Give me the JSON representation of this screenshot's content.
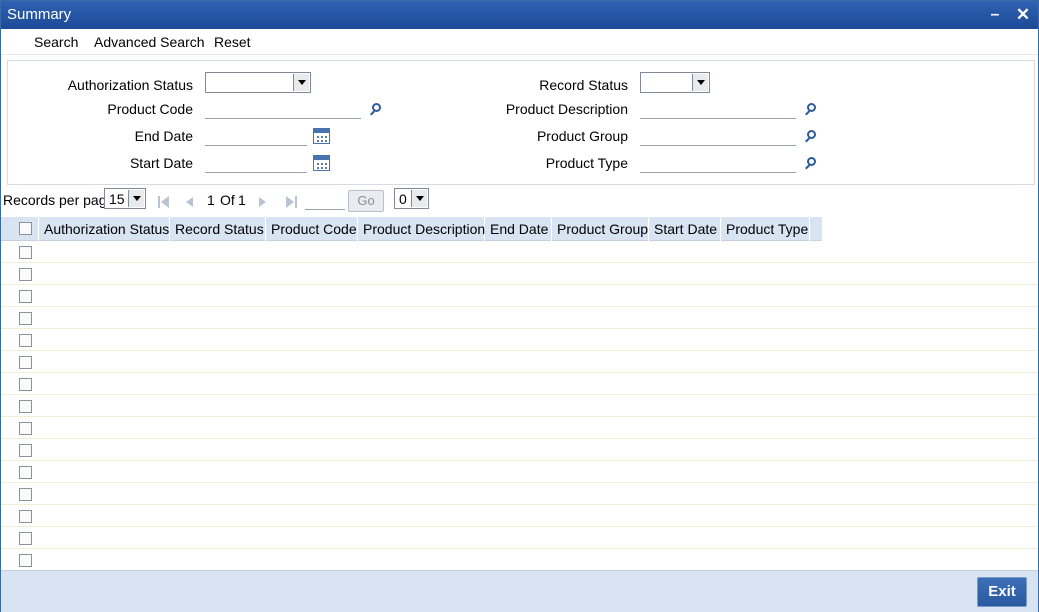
{
  "window": {
    "title": "Summary"
  },
  "menu": {
    "items": [
      "Search",
      "Advanced Search",
      "Reset"
    ]
  },
  "criteria": {
    "authorization_status_label": "Authorization Status",
    "product_code_label": "Product Code",
    "end_date_label": "End Date",
    "start_date_label": "Start Date",
    "record_status_label": "Record Status",
    "product_description_label": "Product Description",
    "product_group_label": "Product Group",
    "product_type_label": "Product Type"
  },
  "pager": {
    "records_per_page_label": "Records per page",
    "records_per_page_value": "15",
    "current_page": "1",
    "of_label": "Of",
    "total_pages": "1",
    "go_label": "Go",
    "jump_select_value": "0"
  },
  "grid": {
    "columns": [
      "Authorization Status",
      "Record Status",
      "Product Code",
      "Product Description",
      "End Date",
      "Product Group",
      "Start Date",
      "Product Type"
    ],
    "row_count": 15
  },
  "footer": {
    "exit_label": "Exit"
  },
  "colors": {
    "titlebar": "#1b4a97",
    "header_bg": "#d9e4f2",
    "footer_bg": "#d8e4f2",
    "accent": "#2c5a9e"
  },
  "icons": {
    "lookup": "magnifier-icon",
    "calendar": "calendar-icon"
  }
}
